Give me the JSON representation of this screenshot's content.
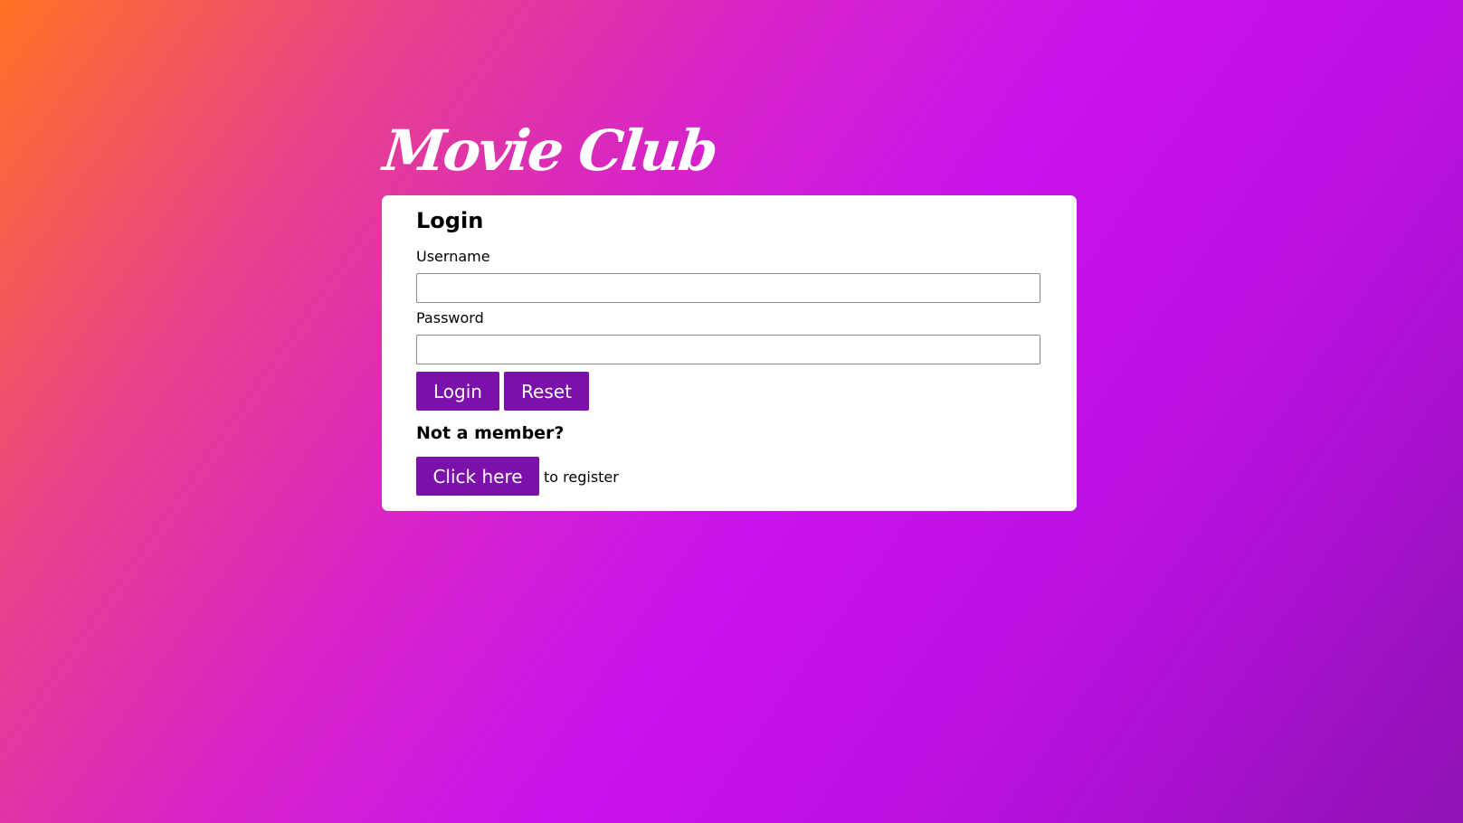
{
  "site": {
    "title": "Movie Club"
  },
  "login_form": {
    "heading": "Login",
    "username_label": "Username",
    "username_value": "",
    "password_label": "Password",
    "password_value": "",
    "login_button": "Login",
    "reset_button": "Reset"
  },
  "register": {
    "heading": "Not a member?",
    "button": "Click here",
    "suffix": "to register"
  },
  "colors": {
    "background_gradient": [
      "#ff7222",
      "#e8428a",
      "#cb12ec",
      "#8e13b4"
    ],
    "card_background": "#ffffff",
    "button_background": "#7b11aa",
    "button_text": "#ffffff"
  }
}
